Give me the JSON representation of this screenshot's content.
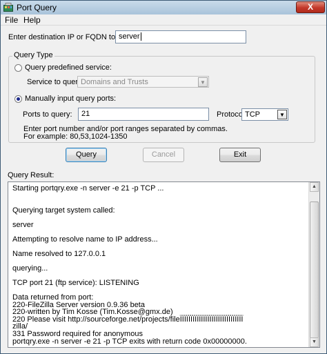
{
  "window": {
    "title": "Port Query",
    "close_glyph": "X"
  },
  "menu": {
    "file": "File",
    "help": "Help"
  },
  "destination": {
    "label": "Enter destination IP or FQDN to query:",
    "value": "server"
  },
  "query_type": {
    "group_label": "Query Type",
    "predefined": {
      "label": "Query predefined service:",
      "selected": false
    },
    "service": {
      "label": "Service to query:",
      "value": "Domains and Trusts"
    },
    "manual": {
      "label": "Manually input query ports:",
      "selected": true
    },
    "ports": {
      "label": "Ports to query:",
      "value": "21"
    },
    "protocol": {
      "label": "Protocol:",
      "value": "TCP"
    },
    "hint_line1": "Enter port number and/or port ranges separated by commas.",
    "hint_line2": "For example: 80,53,1024-1350"
  },
  "buttons": {
    "query": "Query",
    "cancel": "Cancel",
    "exit": "Exit"
  },
  "result": {
    "label": "Query Result:",
    "lines": [
      " Starting portqry.exe -n server -e 21 -p TCP ...",
      "",
      "",
      "Querying target system called:",
      "",
      " server",
      "",
      "Attempting to resolve name to IP address...",
      "",
      "Name resolved to 127.0.0.1",
      "",
      "querying...",
      "",
      "TCP port 21 (ftp service): LISTENING",
      "",
      "Data returned from port:",
      "220-FileZilla Server version 0.9.36 beta",
      "220-written by Tim Kosse (Tim.Kosse@gmx.de)",
      "220 Please visit http://sourceforge.net/projects/fileÏÏÏÏÏÏÏÏÏÏÏÏÏÏÏÏÏÏÏÏÏÏÏÏÏÏÏÏÏÏ",
      "zilla/",
      "331 Password required for anonymous",
      "portqry.exe -n server -e 21 -p TCP exits with return code 0x00000000."
    ]
  }
}
